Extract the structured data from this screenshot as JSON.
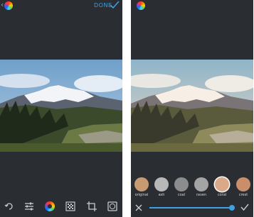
{
  "colors": {
    "accent": "#3aa0e0",
    "panel_bg": "#2a2d31",
    "icon": "#c8cbd0"
  },
  "editor": {
    "done_label": "DONE"
  },
  "toolbar": {
    "tools": [
      "rotate-icon",
      "adjust-icon",
      "color-wheel-icon",
      "grain-icon",
      "crop-icon",
      "vignette-icon"
    ]
  },
  "filters_screen": {
    "items": [
      {
        "label": "original",
        "active": false
      },
      {
        "label": "ash",
        "active": false
      },
      {
        "label": "coal",
        "active": false
      },
      {
        "label": "raven",
        "active": false
      },
      {
        "label": "coral",
        "active": true
      },
      {
        "label": "crest",
        "active": false
      }
    ],
    "intensity": 0.97
  }
}
